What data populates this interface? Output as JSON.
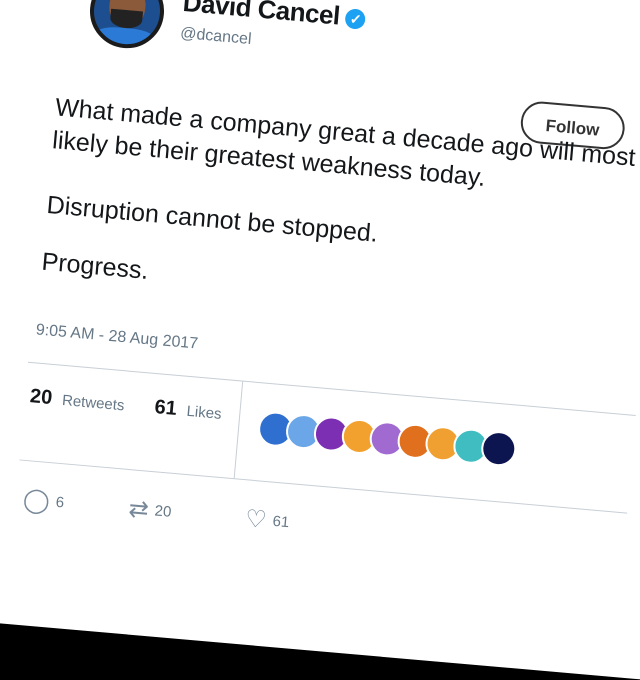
{
  "tweet": {
    "author_name": "David Cancel",
    "handle": "@dcancel",
    "follow_label": "Follow",
    "paragraphs": [
      "What made a company great a decade ago will most likely be their greatest weakness today.",
      "Disruption cannot be stopped.",
      "Progress."
    ],
    "timestamp": "9:05 AM - 28 Aug 2017",
    "stats": {
      "retweets_count": "20",
      "retweets_label": "Retweets",
      "likes_count": "61",
      "likes_label": "Likes"
    },
    "liker_avatar_colors": [
      "#2f6fd0",
      "#6aa6e8",
      "#7d2fb3",
      "#f2a12e",
      "#a06ad0",
      "#e0701d",
      "#f0a030",
      "#3fbdc0",
      "#0c1550"
    ],
    "actions": {
      "reply_count": "6",
      "retweet_count": "20",
      "like_count": "61"
    }
  },
  "icons": {
    "verified": "verified-badge-icon",
    "caret": "chevron-down-icon",
    "reply": "reply-icon",
    "retweet": "retweet-icon",
    "like": "heart-icon"
  }
}
